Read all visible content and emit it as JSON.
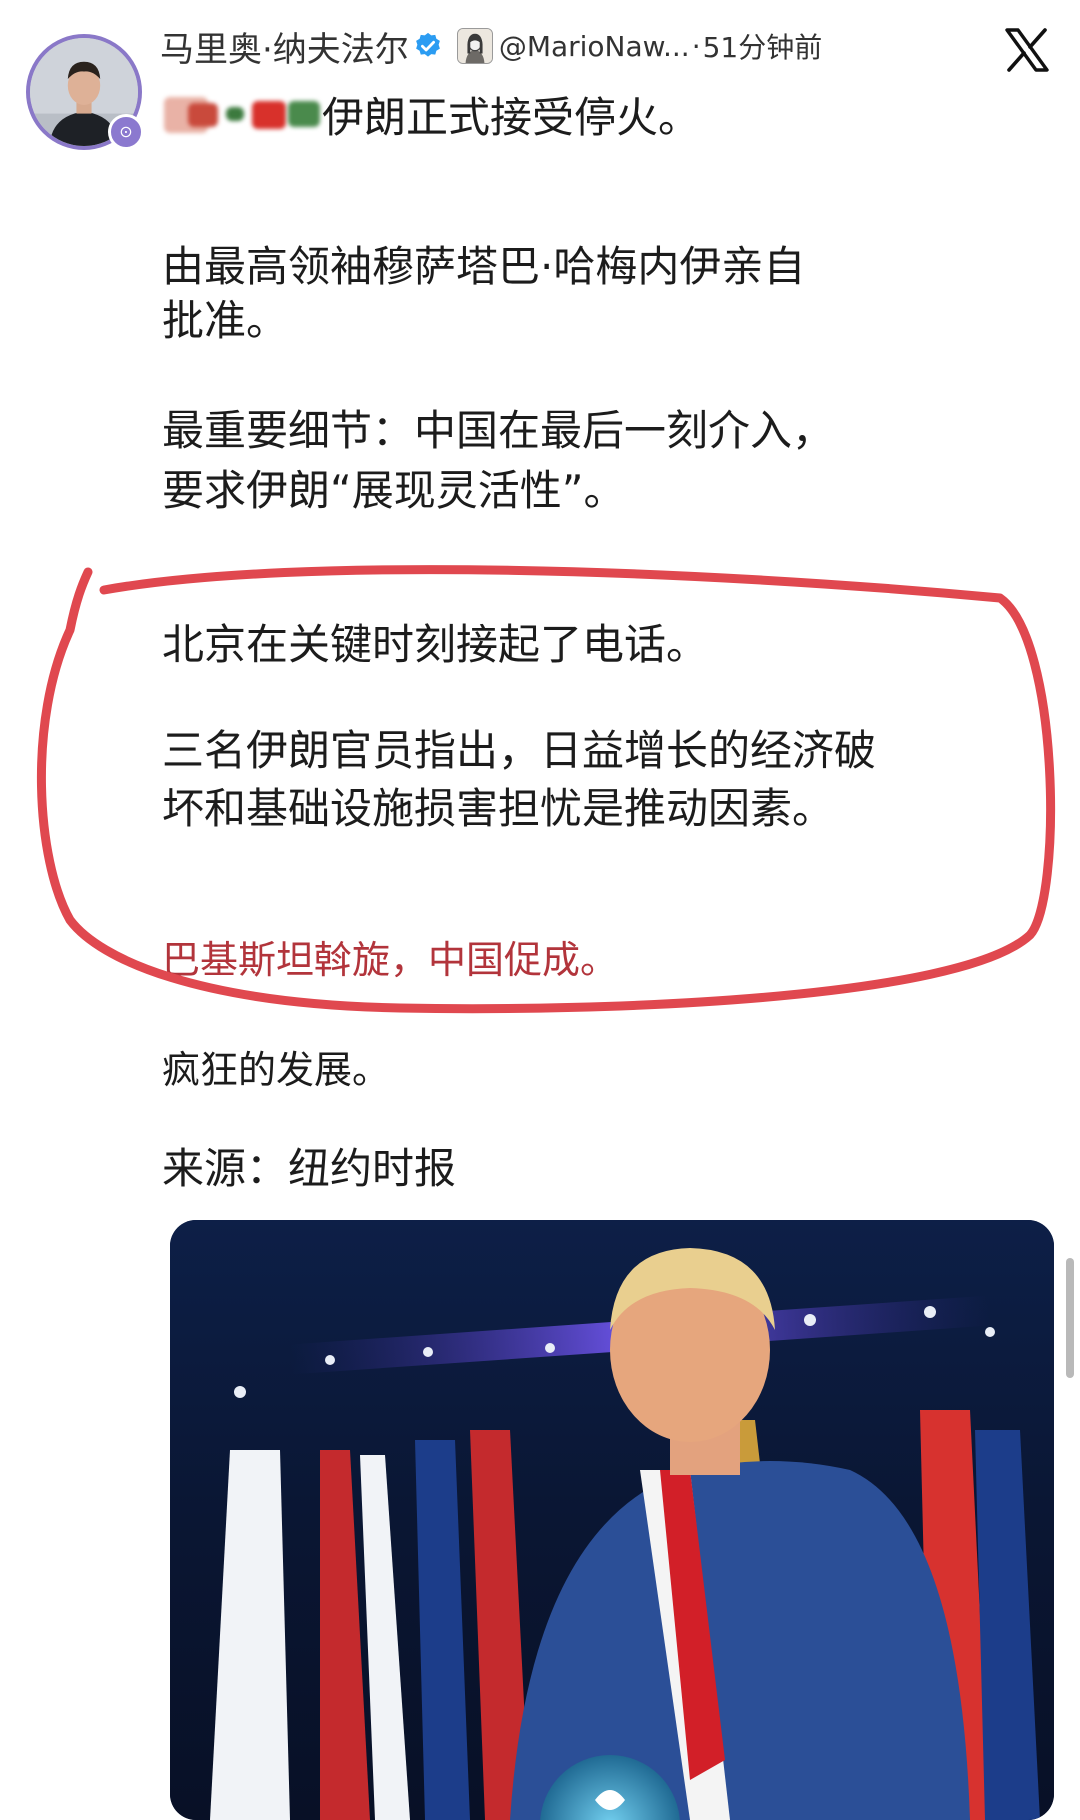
{
  "post": {
    "author_name": "马里奥·纳夫法尔",
    "handle": "@MarioNaw...",
    "separator": "·",
    "time_ago": "51分钟前",
    "platform_icon": "x-logo-icon",
    "verified_icon": "verified-badge-icon",
    "headline_suffix": "伊朗正式接受停火。",
    "paragraphs": {
      "p1_line1": "由最高领袖穆萨塔巴·哈梅内伊亲自",
      "p1_line2": "批准。",
      "p2_line1": "最重要细节：中国在最后一刻介入，",
      "p2_line2": "要求伊朗“展现灵活性”。",
      "p3": "北京在关键时刻接起了电话。",
      "p4_line1": "三名伊朗官员指出，日益增长的经济破",
      "p4_line2": "坏和基础设施损害担忧是推动因素。",
      "p5": "巴基斯坦斡旋，中国促成。",
      "p6": "疯狂的发展。",
      "p7": "来源：纽约时报"
    },
    "highlight_color": "#e0484f",
    "accent_color": "#8b79cf"
  }
}
